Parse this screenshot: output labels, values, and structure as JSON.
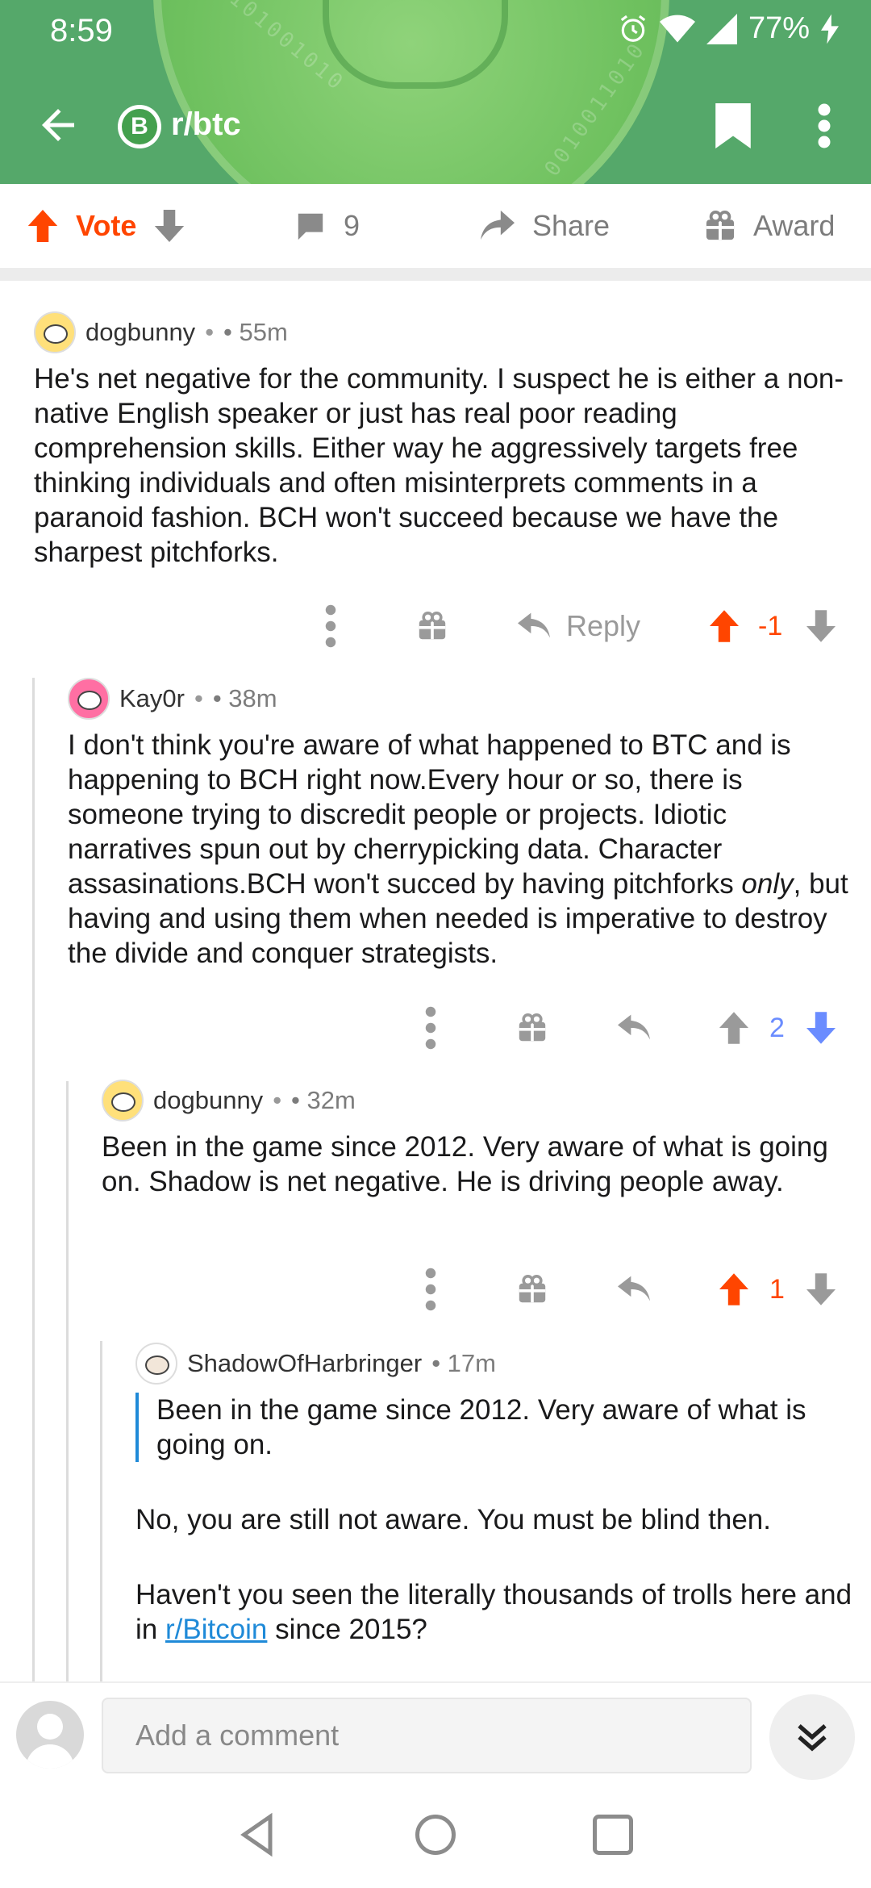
{
  "status_bar": {
    "time": "8:59",
    "battery": "77%"
  },
  "header": {
    "subreddit": "r/btc",
    "badge_symbol": "B"
  },
  "actions": {
    "vote_label": "Vote",
    "comment_count": "9",
    "share_label": "Share",
    "award_label": "Award"
  },
  "comments": [
    {
      "author": "dogbunny",
      "dot": "•",
      "time": "• 55m",
      "text": "He's net negative for the community. I suspect he is either a non-native English speaker or just has real poor reading comprehension skills. Either way he aggressively targets free thinking individuals and often misinterprets comments in a paranoid fashion. BCH won't succeed because we have the sharpest pitchforks.",
      "reply_label": "Reply",
      "score": "-1"
    },
    {
      "author": "Kay0r",
      "dot": "•",
      "time": "• 38m",
      "text_before": "I don't think you're aware of what happened to BTC and is happening to BCH right now.Every hour or so, there is someone trying to discredit people or projects. Idiotic narratives spun out by cherrypicking data. Character assasinations.BCH won't succed by having pitchforks ",
      "text_em": "only",
      "text_after": ", but having and using them when needed is imperative to destroy the divide and conquer strategists.",
      "score": "2"
    },
    {
      "author": "dogbunny",
      "dot": "•",
      "time": "• 32m",
      "text": "Been in the game since 2012. Very aware of what is going on. Shadow is net negative. He is driving people away.",
      "score": "1"
    },
    {
      "author": "ShadowOfHarbringer",
      "time": "• 17m",
      "quote": "Been in the game since 2012. Very aware of what is going on.",
      "para1": "No, you are still not aware. You must be blind then.",
      "para2_before": "Haven't you seen the literally thousands of trolls here and in ",
      "para2_link": "r/Bitcoin",
      "para2_after": " since 2015?"
    }
  ],
  "bottom_bar": {
    "comment_placeholder": "Add a comment"
  },
  "colors": {
    "header_green": "#55a86a",
    "upvote_orange": "#ff4500",
    "downvote_blue": "#6a8cff",
    "link_blue": "#1f8ad8"
  }
}
